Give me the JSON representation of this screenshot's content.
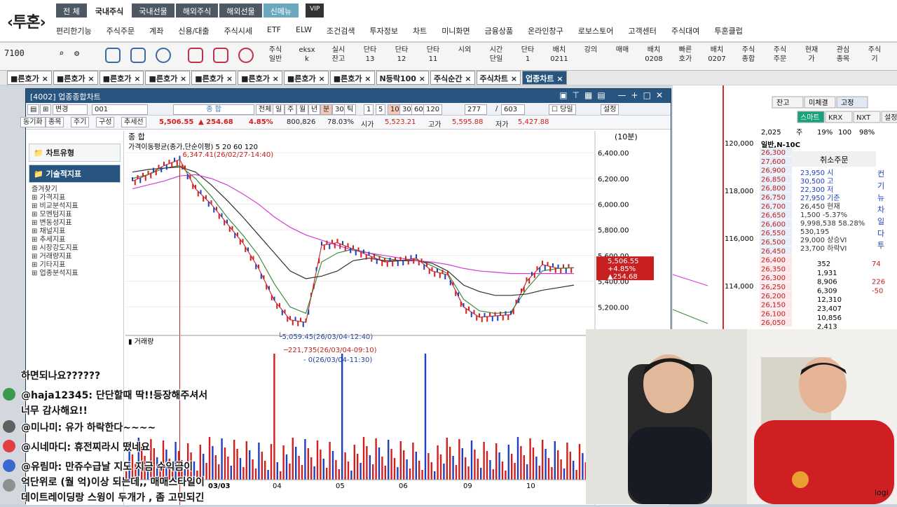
{
  "brand": "투혼",
  "main_tabs": [
    "전 체",
    "국내주식",
    "국내선물",
    "해외주식",
    "해외선물",
    "신메뉴",
    "VIP"
  ],
  "menu": [
    "편리한기능",
    "주식주문",
    "계좌",
    "신용/대출",
    "주식시세",
    "ETF",
    "ELW",
    "조건검색",
    "투자정보",
    "차트",
    "미니화면",
    "금융상품",
    "온라인창구",
    "로보스토어",
    "고객센터",
    "주식대여",
    "투혼클럽"
  ],
  "code_value": "7100",
  "toolbar_buttons": [
    "주식\n일반",
    "eksx\nk",
    "실시\n잔고",
    "단타\n13",
    "단타\n12",
    "단타\n11",
    "시외",
    "시간\n단일",
    "단타\n1",
    "배치\n0211",
    "강의",
    "매매",
    "배치\n0208",
    "빠른\n호가",
    "배치\n0207",
    "주식\n종합",
    "주식\n주문",
    "현재\n가",
    "관심\n종목",
    "주식\n기"
  ],
  "window_tabs": [
    "■른호가",
    "■른호가",
    "■른호가",
    "■른호가",
    "■른호가",
    "■른호가",
    "■른호가",
    "■른호가",
    "N등락100",
    "주식순간",
    "주식차트",
    "업종차트"
  ],
  "chart_window": {
    "title": "[4002] 업종종합차트",
    "code": "001",
    "name": "종 합",
    "type": "변경",
    "all": "전체",
    "periods": [
      "일",
      "주",
      "월",
      "년",
      "분",
      "30s",
      "틱"
    ],
    "minutes": [
      "1",
      "5",
      "10",
      "30",
      "60",
      "120"
    ],
    "active_minute": "10",
    "count": "277",
    "total": "603",
    "same_day": "당일",
    "settings": "설정",
    "sub_tabs": [
      "동기화",
      "종목",
      "주기",
      "구성",
      "추세선"
    ],
    "price": "5,506.55",
    "change": "▲ 254.68",
    "change_pct": "4.85%",
    "volume": "800,826",
    "vol_pct": "78.03%",
    "open_label": "시가",
    "open": "5,523.21",
    "high_label": "고가",
    "high": "5,595.88",
    "low_label": "저가",
    "low": "5,427.88",
    "interval": "(10분)",
    "ma_label": "가격이동평균(종가,단순이평) 5 20 60 120",
    "max_label": "6,347.41(26/02/27-14:40)",
    "min_label": "5,059.45(26/03/04-12:40)",
    "volume_label": "거래량",
    "vol_max_label": "221,735(26/03/04-09:10)",
    "vol_min_label": "0(26/03/04-11:30)",
    "current_box": [
      "5,506.55",
      "+4.85%",
      "▲254.68"
    ],
    "date_labels": [
      "03/03",
      "04",
      "05",
      "06",
      "09",
      "10"
    ]
  },
  "tree": {
    "chart_types": "차트유형",
    "tech": "기술적지표",
    "items": [
      "즐겨찾기",
      "가격지표",
      "비교분석지표",
      "모멘텀지표",
      "변동성지표",
      "채널지표",
      "추세지표",
      "시장강도지표",
      "거래량지표",
      "기타지표",
      "업종분석지표"
    ]
  },
  "right_panel": {
    "tabs": [
      "잔고",
      "미체결",
      "고정"
    ],
    "buttons": [
      "스마트",
      "KRX",
      "NXT",
      "설정"
    ],
    "qty": "2,025",
    "pct": [
      "주",
      "19%",
      "100",
      "98%"
    ],
    "order_name": "일반,N-10C",
    "cancel": "취소주문",
    "prices": [
      "26,300",
      "27,600",
      "26,900",
      "26,850",
      "26,800",
      "26,750",
      "26,700",
      "26,650",
      "26,600",
      "26,550",
      "26,500",
      "26,450",
      "26,400",
      "26,350",
      "26,300",
      "26,250",
      "26,200",
      "26,150",
      "26,100",
      "26,050"
    ],
    "asks": [
      "23,950 시",
      "30,500 고",
      "22,300 저",
      "27,950 기준",
      "26,450 현재",
      "1,500 -5.37%",
      "9,998,538 58.28%",
      "530,195",
      "29,000 상승VI",
      "23,700 하락VI"
    ],
    "bid_qty": [
      "352",
      "1,931",
      "8,906",
      "6,309",
      "12,310",
      "23,407",
      "10,856",
      "2,413"
    ],
    "bid_extra": [
      "74",
      "",
      "226",
      "-50",
      "",
      "",
      "",
      ""
    ],
    "side_vertical": [
      "컨",
      "기",
      "뉴",
      "차",
      "일",
      "다",
      "투"
    ]
  },
  "right_axis": [
    "120,000",
    "118,000",
    "116,000",
    "114,000",
    "112,000",
    "110,000"
  ],
  "chat": [
    {
      "text": "하면되나요??????"
    },
    {
      "text": "@haja12345: 단단할때 딱!!등장해주셔서"
    },
    {
      "text": "너무 감사해요!!"
    },
    {
      "text": "@미나미: 유가 하락한다~~~~"
    },
    {
      "text": "@시네마디: 휴전찌라시 떴네요"
    },
    {
      "text": "@유림마: 만쥬수급날 지도 지금 수익금이"
    },
    {
      "text": "억단위로 (월 억)이상 되는데,, 매매스타일이"
    },
    {
      "text": "데이트레이딩랑 스윙이 두개가 , 좀 고민되긴"
    }
  ],
  "chart_data": {
    "type": "line",
    "title": "업종종합차트 종합 (10분)",
    "ylabel": "",
    "ylim": [
      5000,
      6450
    ],
    "y_ticks": [
      6400,
      6200,
      6000,
      5800,
      5600,
      5400,
      5200
    ],
    "x_labels": [
      "03/03",
      "04",
      "05",
      "06",
      "09",
      "10"
    ],
    "series": [
      {
        "name": "5",
        "values": [
          6180,
          6230,
          6300,
          6347,
          6120,
          6000,
          5850,
          5700,
          5500,
          5250,
          5100,
          5080,
          5680,
          5700,
          5650,
          5600,
          5550,
          5560,
          5580,
          5480,
          5450,
          5200,
          5120,
          5130,
          5140,
          5400,
          5530,
          5500,
          5506
        ]
      },
      {
        "name": "20",
        "values": [
          6200,
          6230,
          6280,
          6300,
          6200,
          6060,
          5900,
          5760,
          5600,
          5380,
          5200,
          5150,
          5550,
          5620,
          5650,
          5620,
          5580,
          5560,
          5570,
          5520,
          5460,
          5260,
          5170,
          5150,
          5160,
          5340,
          5480,
          5500,
          5505
        ]
      },
      {
        "name": "60",
        "values": [
          6250,
          6270,
          6280,
          6290,
          6250,
          6150,
          6030,
          5900,
          5760,
          5620,
          5480,
          5420,
          5440,
          5480,
          5560,
          5580,
          5560,
          5560,
          5560,
          5540,
          5480,
          5370,
          5320,
          5290,
          5290,
          5300,
          5330,
          5350,
          5370
        ]
      },
      {
        "name": "120",
        "values": [
          6120,
          6150,
          6180,
          6220,
          6230,
          6200,
          6150,
          6080,
          6000,
          5900,
          5820,
          5760,
          5720,
          5680,
          5640,
          5620,
          5600,
          5580,
          5560,
          5550,
          5530,
          5500,
          5480,
          5470,
          5460,
          5460,
          5460,
          5460,
          5460
        ]
      }
    ],
    "volume_max": 221735,
    "colors": {
      "5": "#c8333a",
      "20": "#3c8c3c",
      "60": "#2f2f2f",
      "120": "#d43cd4",
      "up": "#d02020",
      "down": "#2040c0"
    }
  }
}
